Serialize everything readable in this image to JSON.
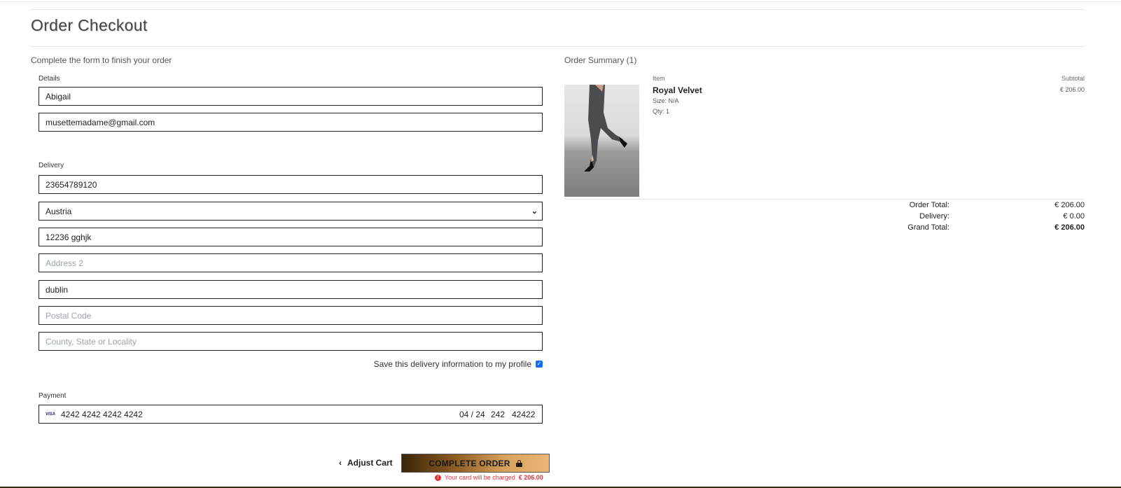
{
  "header": {
    "title": "Order Checkout"
  },
  "form": {
    "intro": "Complete the form to finish your order",
    "details_label": "Details",
    "full_name": "Abigail",
    "email": "musettemadame@gmail.com",
    "delivery_label": "Delivery",
    "phone": "23654789120",
    "country": "Austria",
    "address1": "12236 gghjk",
    "address2_placeholder": "Address 2",
    "town": "dublin",
    "postcode_placeholder": "Postal Code",
    "county_placeholder": "County, State or Locality",
    "save_info_label": "Save this delivery information to my profile",
    "save_info_checked": true,
    "payment_label": "Payment",
    "card": {
      "brand": "VISA",
      "number": "4242 4242 4242 4242",
      "expiry": "04 / 24",
      "cvc": "242",
      "zip": "42422"
    }
  },
  "actions": {
    "adjust_cart": "Adjust Cart",
    "complete_order": "COMPLETE ORDER",
    "charge_prefix": "Your card will be charged",
    "charge_amount": "€ 206.00"
  },
  "summary": {
    "title": "Order Summary (1)",
    "item_col": "Item",
    "subtotal_col": "Subtotal",
    "item": {
      "name": "Royal Velvet",
      "size": "Size: N/A",
      "qty": "Qty: 1",
      "subtotal": "€ 206.00"
    },
    "order_total_label": "Order Total:",
    "order_total": "€ 206.00",
    "delivery_label": "Delivery:",
    "delivery": "€ 0.00",
    "grand_total_label": "Grand Total:",
    "grand_total": "€ 206.00"
  },
  "colors": {
    "error": "#dd3333",
    "checkbox": "#0d6efd",
    "button_gradient_start": "#3a2408",
    "button_gradient_end": "#eab777"
  }
}
